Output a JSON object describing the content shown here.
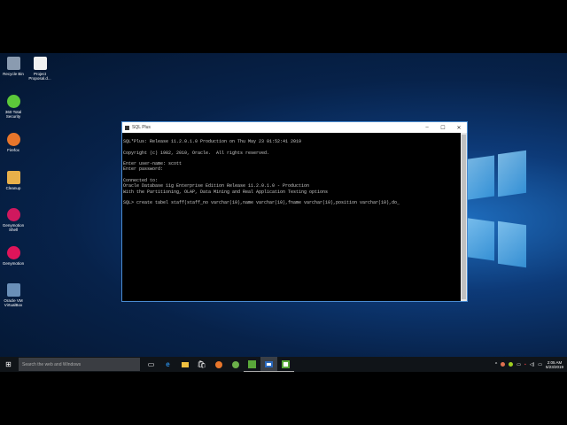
{
  "desktop": {
    "icons": [
      {
        "label": "Recycle Bin",
        "name": "recycle-bin",
        "color": "#8a9bb0"
      },
      {
        "label": "Project Proposal.d...",
        "name": "project-proposal",
        "color": "#f2f2f2"
      },
      {
        "label": "360 Total Security",
        "name": "360-total-security",
        "color": "#5cc83a"
      },
      {
        "label": "Firefox",
        "name": "firefox",
        "color": "#e8762b"
      },
      {
        "label": "Cleanup",
        "name": "cleanup",
        "color": "#e8b04a"
      },
      {
        "label": "Genymotion Shell",
        "name": "genymotion-shell",
        "color": "#d0185e"
      },
      {
        "label": "Genymotion",
        "name": "genymotion",
        "color": "#e0145a"
      },
      {
        "label": "Oracle VM VirtualBox",
        "name": "virtualbox",
        "color": "#6a8fb8"
      }
    ]
  },
  "window": {
    "title": "SQL Plus",
    "minimize": "–",
    "maximize": "☐",
    "close": "✕",
    "lines": [
      "SQL*Plus: Release 11.2.0.1.0 Production on Thu May 23 01:52:41 2019",
      "",
      "Copyright (c) 1982, 2010, Oracle.  All rights reserved.",
      "",
      "Enter user-name: scott",
      "Enter password:",
      "",
      "Connected to:",
      "Oracle Database 11g Enterprise Edition Release 11.2.0.1.0 - Production",
      "With the Partitioning, OLAP, Data Mining and Real Application Testing options",
      "",
      "SQL> create tabel staff(staff_no varchar(10),name varchar(10),fname varchar(10),position varchar(10),do_"
    ]
  },
  "taskbar": {
    "search_placeholder": "Search the web and Windows",
    "time": "2:05 AM",
    "date": "5/23/2019"
  }
}
